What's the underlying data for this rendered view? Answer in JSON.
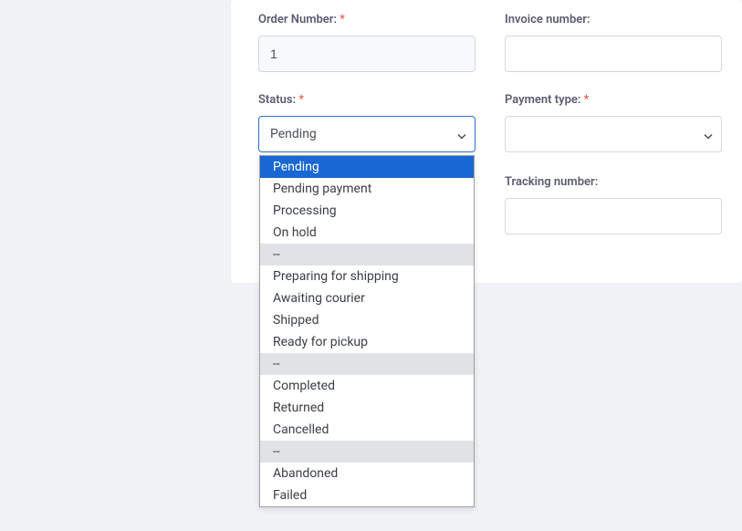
{
  "fields": {
    "order_number": {
      "label": "Order Number:",
      "required": true,
      "value": "1"
    },
    "invoice_number": {
      "label": "Invoice number:",
      "required": false,
      "value": ""
    },
    "status": {
      "label": "Status:",
      "required": true,
      "selected": "Pending"
    },
    "payment_type": {
      "label": "Payment type:",
      "required": true,
      "selected": ""
    },
    "tracking_number": {
      "label": "Tracking number:",
      "required": false,
      "value": ""
    }
  },
  "required_marker": "*",
  "status_options": [
    {
      "type": "option",
      "label": "Pending",
      "selected": true
    },
    {
      "type": "option",
      "label": "Pending payment"
    },
    {
      "type": "option",
      "label": "Processing"
    },
    {
      "type": "option",
      "label": "On hold"
    },
    {
      "type": "separator",
      "label": "--"
    },
    {
      "type": "option",
      "label": "Preparing for shipping"
    },
    {
      "type": "option",
      "label": "Awaiting courier"
    },
    {
      "type": "option",
      "label": "Shipped"
    },
    {
      "type": "option",
      "label": "Ready for pickup"
    },
    {
      "type": "separator",
      "label": "--"
    },
    {
      "type": "option",
      "label": "Completed"
    },
    {
      "type": "option",
      "label": "Returned"
    },
    {
      "type": "option",
      "label": "Cancelled"
    },
    {
      "type": "separator",
      "label": "--"
    },
    {
      "type": "option",
      "label": "Abandoned"
    },
    {
      "type": "option",
      "label": "Failed"
    }
  ]
}
